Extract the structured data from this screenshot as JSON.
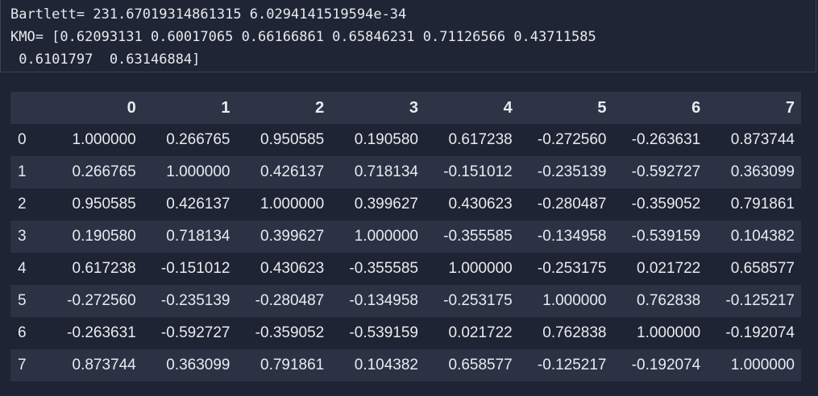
{
  "output": {
    "lines": [
      "Bartlett= 231.67019314861315 6.0294141519594e-34",
      "KMO= [0.62093131 0.60017065 0.66166861 0.65846231 0.71126566 0.43711585",
      " 0.6101797  0.63146884]"
    ]
  },
  "table": {
    "headers": [
      "",
      "0",
      "1",
      "2",
      "3",
      "4",
      "5",
      "6",
      "7"
    ],
    "rows": [
      [
        "0",
        "1.000000",
        "0.266765",
        "0.950585",
        "0.190580",
        "0.617238",
        "-0.272560",
        "-0.263631",
        "0.873744"
      ],
      [
        "1",
        "0.266765",
        "1.000000",
        "0.426137",
        "0.718134",
        "-0.151012",
        "-0.235139",
        "-0.592727",
        "0.363099"
      ],
      [
        "2",
        "0.950585",
        "0.426137",
        "1.000000",
        "0.399627",
        "0.430623",
        "-0.280487",
        "-0.359052",
        "0.791861"
      ],
      [
        "3",
        "0.190580",
        "0.718134",
        "0.399627",
        "1.000000",
        "-0.355585",
        "-0.134958",
        "-0.539159",
        "0.104382"
      ],
      [
        "4",
        "0.617238",
        "-0.151012",
        "0.430623",
        "-0.355585",
        "1.000000",
        "-0.253175",
        "0.021722",
        "0.658577"
      ],
      [
        "5",
        "-0.272560",
        "-0.235139",
        "-0.280487",
        "-0.134958",
        "-0.253175",
        "1.000000",
        "0.762838",
        "-0.125217"
      ],
      [
        "6",
        "-0.263631",
        "-0.592727",
        "-0.359052",
        "-0.539159",
        "0.021722",
        "0.762838",
        "1.000000",
        "-0.192074"
      ],
      [
        "7",
        "0.873744",
        "0.363099",
        "0.791861",
        "0.104382",
        "0.658577",
        "-0.125217",
        "-0.192074",
        "1.000000"
      ]
    ]
  }
}
